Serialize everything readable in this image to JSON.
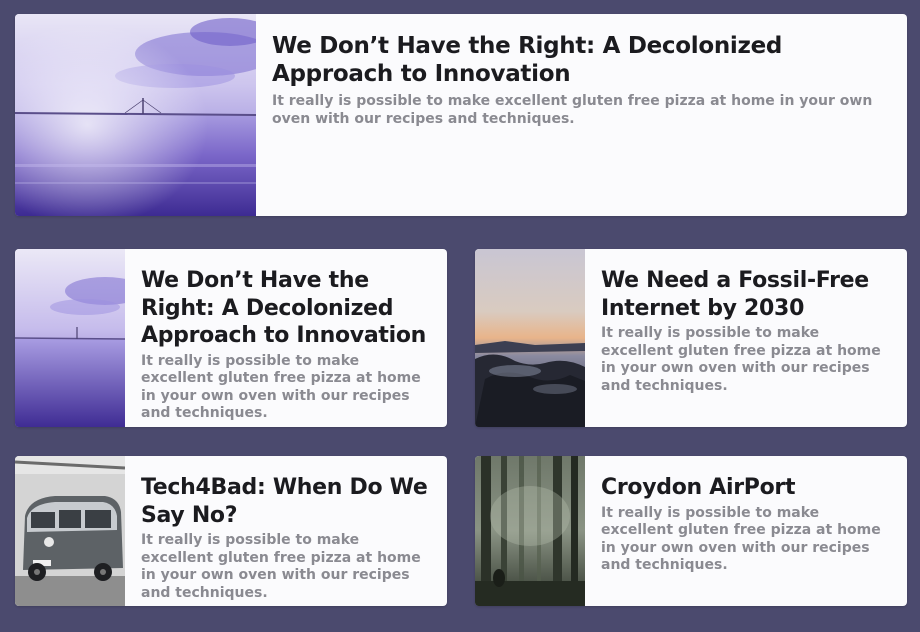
{
  "featured": {
    "title": "We Don’t Have the Right: A Decolonized Approach to Innovation",
    "description": "It really is possible to make excellent gluten free pizza at home in your own oven with our recipes and techniques.",
    "image": "sea-bridge-purple-image"
  },
  "cards": [
    {
      "title": "We Don’t Have the Right: A Decolonized Approach to Innovation",
      "description": "It really is possible to make excellent gluten free pizza at home in your own oven with our recipes and techniques.",
      "image": "sea-bridge-purple-image"
    },
    {
      "title": "We Need a Fossil-Free Internet by 2030",
      "description": "It really is possible to make excellent gluten free pizza at home in your own oven with our recipes and techniques.",
      "image": "rocky-coast-sunset-image"
    },
    {
      "title": "Tech4Bad: When Do We Say No?",
      "description": "It really is possible to make excellent gluten free pizza at home in your own oven with our recipes and techniques.",
      "image": "vintage-van-image"
    },
    {
      "title": "Croydon AirPort",
      "description": "It really is possible to make excellent gluten free pizza at home in your own oven with our recipes and techniques.",
      "image": "misty-forest-image"
    }
  ],
  "colors": {
    "background": "#4b4a6e",
    "card": "#fbfbfd",
    "title": "#1b1b1f",
    "description": "#8a8a91"
  }
}
